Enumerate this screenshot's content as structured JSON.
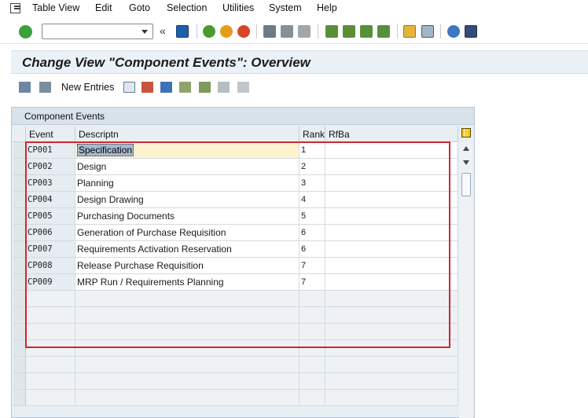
{
  "menu": {
    "items": [
      "Table View",
      "Edit",
      "Goto",
      "Selection",
      "Utilities",
      "System",
      "Help"
    ]
  },
  "toolbar": {
    "command_value": "",
    "back_glyph": "«"
  },
  "title": "Change View \"Component Events\": Overview",
  "app_toolbar": {
    "new_entries": "New Entries"
  },
  "panel": {
    "caption": "Component Events",
    "columns": {
      "event": "Event",
      "descr": "Descriptn",
      "rank": "Rank",
      "rfba": "RfBa"
    },
    "rows": [
      {
        "event": "CP001",
        "descr": "Specification",
        "rank": "1",
        "rfba": ""
      },
      {
        "event": "CP002",
        "descr": "Design",
        "rank": "2",
        "rfba": ""
      },
      {
        "event": "CP003",
        "descr": "Planning",
        "rank": "3",
        "rfba": ""
      },
      {
        "event": "CP004",
        "descr": "Design Drawing",
        "rank": "4",
        "rfba": ""
      },
      {
        "event": "CP005",
        "descr": "Purchasing Documents",
        "rank": "5",
        "rfba": ""
      },
      {
        "event": "CP006",
        "descr": "Generation of Purchase Requisition",
        "rank": "6",
        "rfba": ""
      },
      {
        "event": "CP007",
        "descr": "Requirements Activation Reservation",
        "rank": "6",
        "rfba": ""
      },
      {
        "event": "CP008",
        "descr": "Release Purchase Requisition",
        "rank": "7",
        "rfba": ""
      },
      {
        "event": "CP009",
        "descr": "MRP Run / Requirements Planning",
        "rank": "7",
        "rfba": ""
      }
    ]
  },
  "colors": {
    "highlight_box": "#d0262e",
    "title_bg": "#eaf1f7",
    "focus_row": "#fdf3d0"
  }
}
